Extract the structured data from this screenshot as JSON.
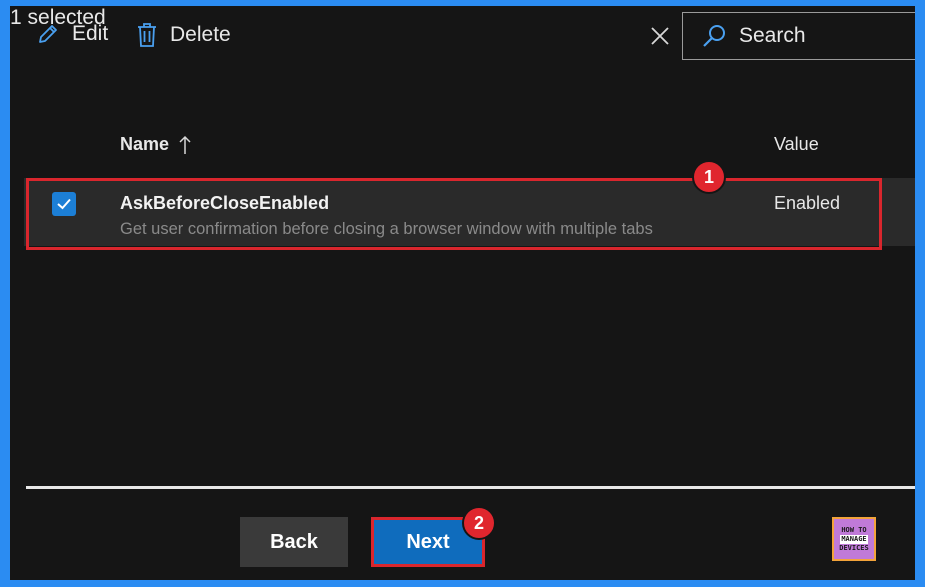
{
  "toolbar": {
    "edit_label": "Edit",
    "delete_label": "Delete",
    "selection_text": "1 selected",
    "search_placeholder": "Search"
  },
  "table": {
    "columns": [
      "Name",
      "Value"
    ],
    "sort": "ascending",
    "rows": [
      {
        "selected": true,
        "name": "AskBeforeCloseEnabled",
        "description": "Get user confirmation before closing a browser window with multiple tabs",
        "value": "Enabled"
      }
    ]
  },
  "callouts": [
    "1",
    "2"
  ],
  "footer": {
    "back_label": "Back",
    "next_label": "Next"
  },
  "logo": {
    "lines": [
      "HOW TO",
      "MANAGE",
      "DEVICES"
    ]
  },
  "colors": {
    "accent": "#0f6cbd",
    "highlight": "#d9262d",
    "background": "#151515",
    "frame": "#2b8cf2"
  }
}
